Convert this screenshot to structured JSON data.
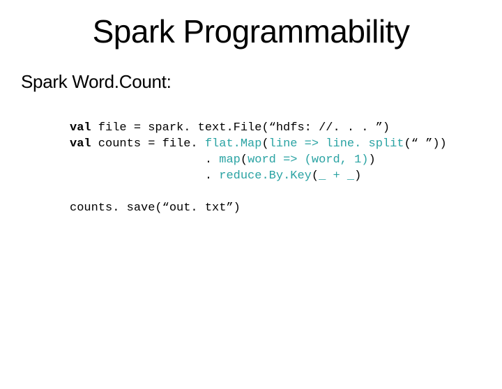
{
  "title": "Spark Programmability",
  "subtitle": "Spark Word.Count:",
  "code": {
    "l1_kw": "val",
    "l1_rest": " file = spark. text.File(“hdfs: //. . . ”)",
    "l2_kw": "val",
    "l2_a": " counts = file. ",
    "l2_fn": "flat.Map",
    "l2_b": "(",
    "l2_arg": "line => line. split",
    "l2_c": "(“ ”))",
    "l3_pad": "                   . ",
    "l3_fn": "map",
    "l3_b": "(",
    "l3_arg": "word => (word, 1)",
    "l3_c": ")",
    "l4_pad": "                   . ",
    "l4_fn": "reduce.By.Key",
    "l4_b": "(",
    "l4_arg": "_ + _",
    "l4_c": ")",
    "l5": "counts. save(“out. txt”)"
  }
}
